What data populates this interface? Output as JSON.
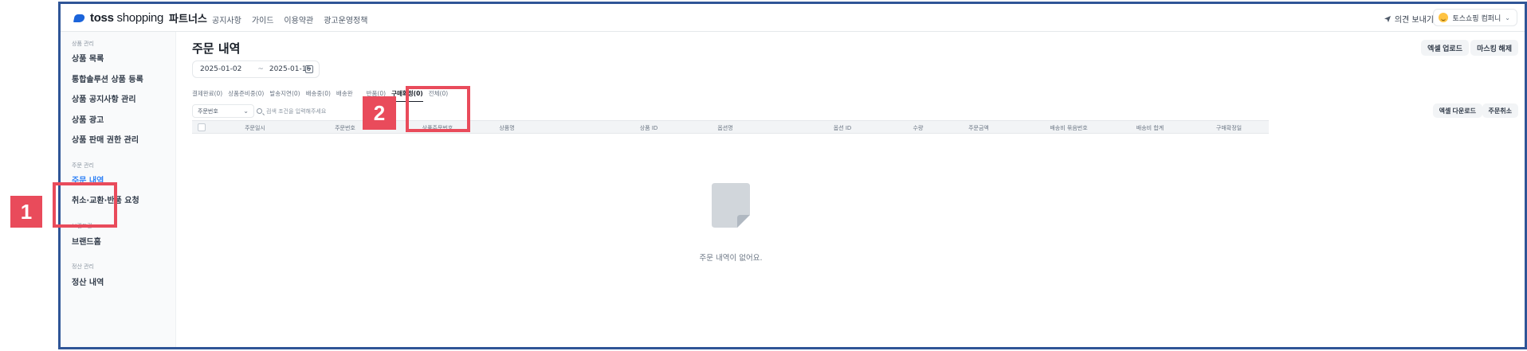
{
  "topbar": {
    "logo_text_bold": "toss",
    "logo_text_light": "shopping",
    "logo_sub": "파트너스",
    "nav": [
      "공지사항",
      "가이드",
      "이용약관",
      "광고운영정책"
    ],
    "feedback_label": "의견 보내기",
    "account_name": "토스쇼핑 컴퍼니"
  },
  "sidebar": {
    "groups": [
      {
        "label": "상품 관리",
        "items": [
          "상품 목록",
          "통합솔루션 상품 등록",
          "상품 공지사항 관리",
          "상품 광고",
          "상품 판매 권한 관리"
        ]
      },
      {
        "label": "주문 관리",
        "items": [
          "주문 내역",
          "취소·교환·반품 요청"
        ]
      },
      {
        "label": "브랜드관",
        "items": [
          "브랜드홈"
        ]
      },
      {
        "label": "정산 관리",
        "items": [
          "정산 내역"
        ]
      }
    ],
    "active_item": "주문 내역"
  },
  "main": {
    "title": "주문 내역",
    "excel_upload": "엑셀 업로드",
    "masking_release": "마스킹 해제",
    "date_start": "2025-01-02",
    "date_sep": "~",
    "date_end": "2025-01-16",
    "tabs": [
      "결제완료(0)",
      "상품준비중(0)",
      "발송지연(0)",
      "배송중(0)",
      "배송완",
      "반품(0)",
      "구매확정(0)",
      "전체(0)"
    ],
    "active_tab": "구매확정(0)",
    "search_field_select": "주문번호",
    "search_placeholder": "검색 조건을 입력해주세요",
    "excel_download": "엑셀 다운로드",
    "cancel_order": "주문취소",
    "columns": [
      "주문일시",
      "주문번호",
      "상품주문번호",
      "상품명",
      "상품 ID",
      "옵션명",
      "옵션 ID",
      "수량",
      "주문금액",
      "배송비 묶음번호",
      "배송비 합계",
      "구매확정일"
    ],
    "empty_message": "주문 내역이 없어요."
  },
  "annotations": {
    "badge_1": "1",
    "badge_2": "2"
  },
  "colors": {
    "accent": "#3182f6",
    "annotation": "#e94b5b",
    "frame_border": "#2f5597",
    "logo": "#1b64da"
  }
}
